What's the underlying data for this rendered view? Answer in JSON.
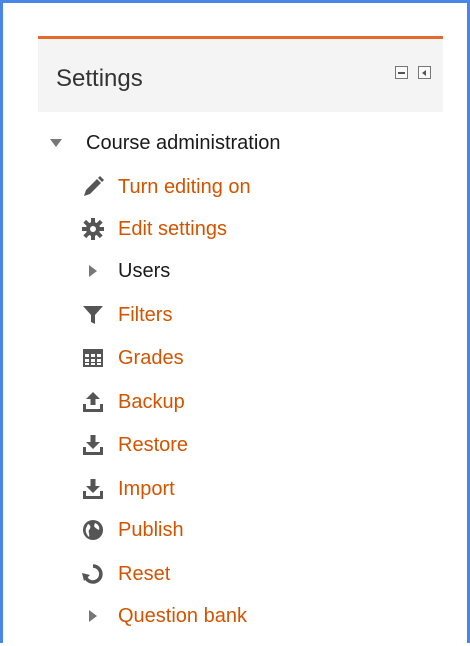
{
  "block": {
    "title": "Settings",
    "controls": {
      "hide_icon": "minus-box-icon",
      "dock_icon": "dock-left-icon"
    }
  },
  "tree": {
    "root": {
      "label": "Course administration",
      "icon": "caret-down-icon"
    },
    "items": [
      {
        "label": "Turn editing on",
        "icon": "pencil-icon"
      },
      {
        "label": "Edit settings",
        "icon": "gear-icon"
      },
      {
        "label": "Users",
        "icon": "caret-right-icon"
      },
      {
        "label": "Filters",
        "icon": "filter-icon"
      },
      {
        "label": "Grades",
        "icon": "table-icon"
      },
      {
        "label": "Backup",
        "icon": "upload-icon"
      },
      {
        "label": "Restore",
        "icon": "download-icon"
      },
      {
        "label": "Import",
        "icon": "download-icon"
      },
      {
        "label": "Publish",
        "icon": "globe-icon"
      },
      {
        "label": "Reset",
        "icon": "refresh-icon"
      },
      {
        "label": "Question bank",
        "icon": "caret-right-icon"
      }
    ]
  },
  "colors": {
    "link": "#d35400",
    "accent": "#e3692c",
    "frame": "#4a86e8",
    "icon": "#555555"
  }
}
